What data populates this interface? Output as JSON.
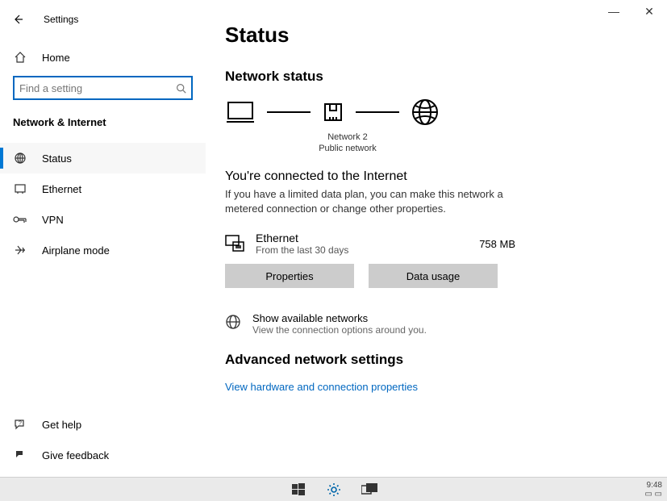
{
  "window": {
    "title": "Settings",
    "minimize_glyph": "—",
    "close_glyph": "✕"
  },
  "sidebar": {
    "home_label": "Home",
    "search_placeholder": "Find a setting",
    "category": "Network & Internet",
    "items": [
      {
        "label": "Status"
      },
      {
        "label": "Ethernet"
      },
      {
        "label": "VPN"
      },
      {
        "label": "Airplane mode"
      }
    ],
    "help_label": "Get help",
    "feedback_label": "Give feedback"
  },
  "main": {
    "page_title": "Status",
    "network_status_heading": "Network status",
    "diagram": {
      "name": "Network 2",
      "type": "Public network"
    },
    "connected_title": "You're connected to the Internet",
    "connected_sub": "If you have a limited data plan, you can make this network a metered connection or change other properties.",
    "adapter": {
      "name": "Ethernet",
      "period": "From the last 30 days",
      "usage": "758 MB"
    },
    "buttons": {
      "properties": "Properties",
      "data_usage": "Data usage"
    },
    "available": {
      "title": "Show available networks",
      "sub": "View the connection options around you."
    },
    "advanced_heading": "Advanced network settings",
    "hw_link": "View hardware and connection properties"
  },
  "taskbar": {
    "clock": "9:48",
    "tray": "▭ ▭"
  }
}
